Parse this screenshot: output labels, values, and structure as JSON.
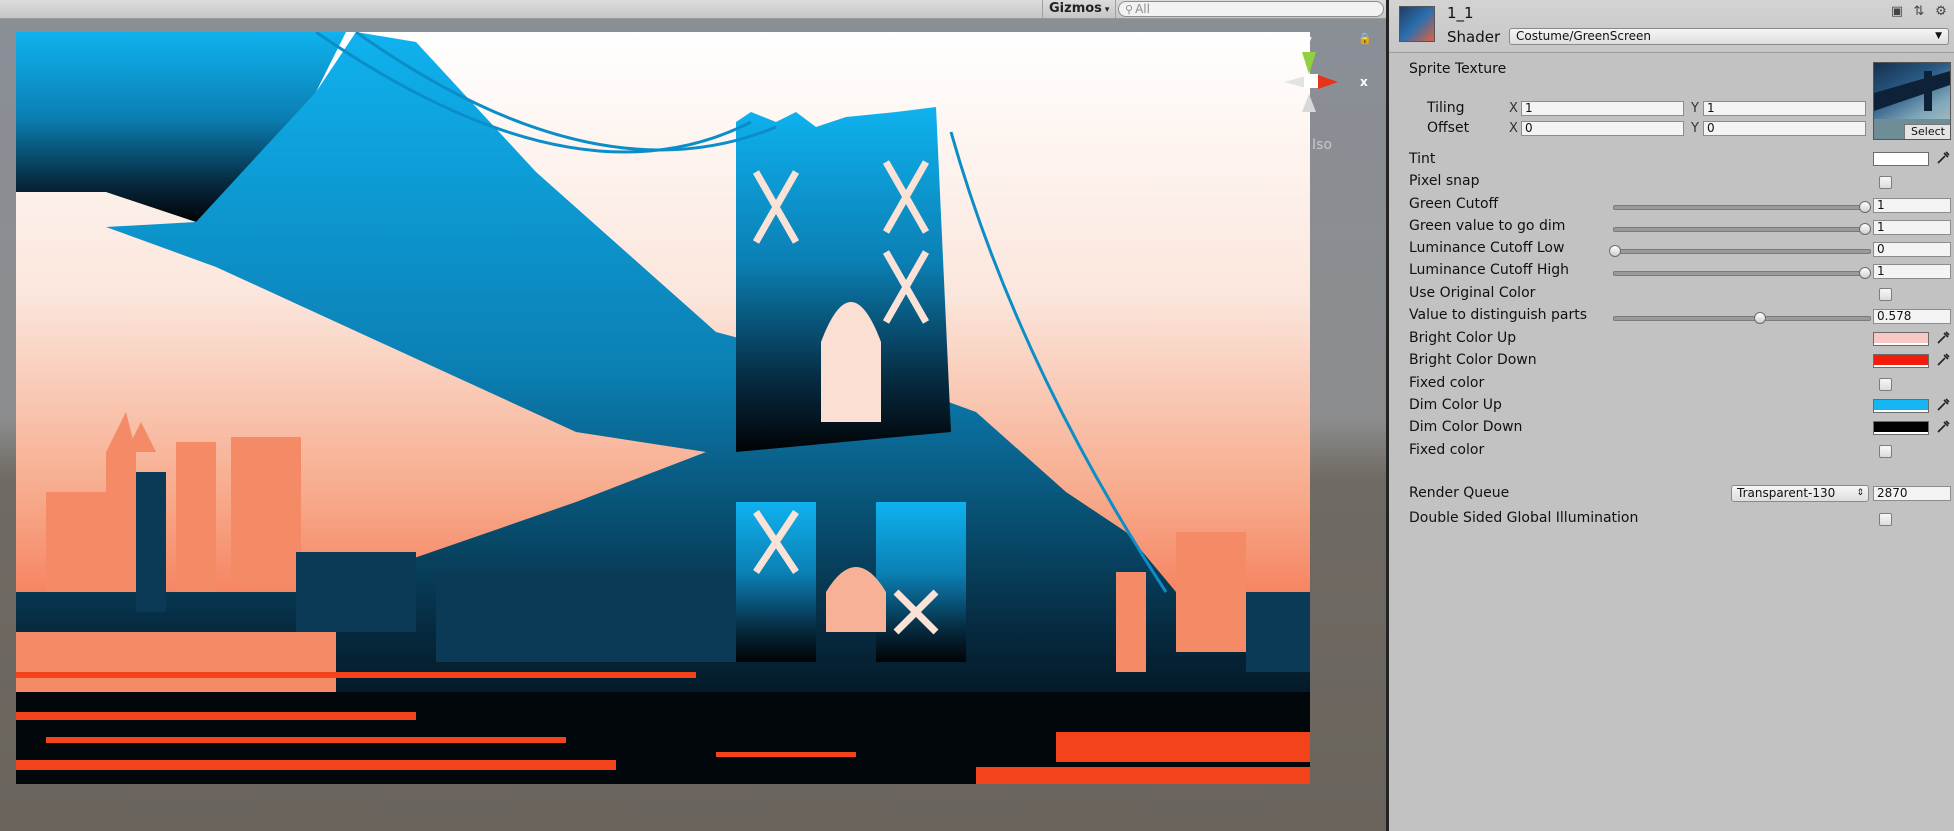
{
  "scene": {
    "gizmos_label": "Gizmos",
    "search_placeholder": "All",
    "axis_y": "y",
    "axis_x": "x",
    "iso_label": "Iso"
  },
  "material": {
    "name": "1_1",
    "shader_label": "Shader",
    "shader_value": "Costume/GreenScreen"
  },
  "properties": {
    "sprite_texture": "Sprite Texture",
    "tiling_label": "Tiling",
    "offset_label": "Offset",
    "x_label": "X",
    "y_label": "Y",
    "tiling_x": "1",
    "tiling_y": "1",
    "offset_x": "0",
    "offset_y": "0",
    "select_label": "Select",
    "tint": "Tint",
    "pixel_snap": "Pixel snap",
    "green_cutoff": "Green Cutoff",
    "green_cutoff_value": "1",
    "green_dim": "Green value to go dim",
    "green_dim_value": "1",
    "lum_low": "Luminance Cutoff Low",
    "lum_low_value": "0",
    "lum_high": "Luminance Cutoff High",
    "lum_high_value": "1",
    "use_original": "Use Original Color",
    "distinguish": "Value to distinguish parts",
    "distinguish_value": "0.578",
    "bright_up": "Bright Color Up",
    "bright_down": "Bright Color Down",
    "fixed_color_1": "Fixed color",
    "dim_up": "Dim Color Up",
    "dim_down": "Dim Color Down",
    "fixed_color_2": "Fixed color",
    "render_queue": "Render Queue",
    "render_queue_mode": "Transparent-130",
    "render_queue_value": "2870",
    "double_sided": "Double Sided Global Illumination"
  },
  "sliders": {
    "green_cutoff": 1,
    "green_dim": 1,
    "lum_low": 0,
    "lum_high": 1,
    "distinguish": 0.578
  },
  "colors": {
    "tint": "#ffffff",
    "bright_up": "#f8c8c4",
    "bright_down": "#f21c0a",
    "dim_up": "#15b4f2",
    "dim_down": "#000000"
  },
  "icons": [
    "search-icon",
    "lock-icon",
    "eyedropper-icon",
    "book-icon",
    "settings-icon",
    "layout-icon"
  ]
}
